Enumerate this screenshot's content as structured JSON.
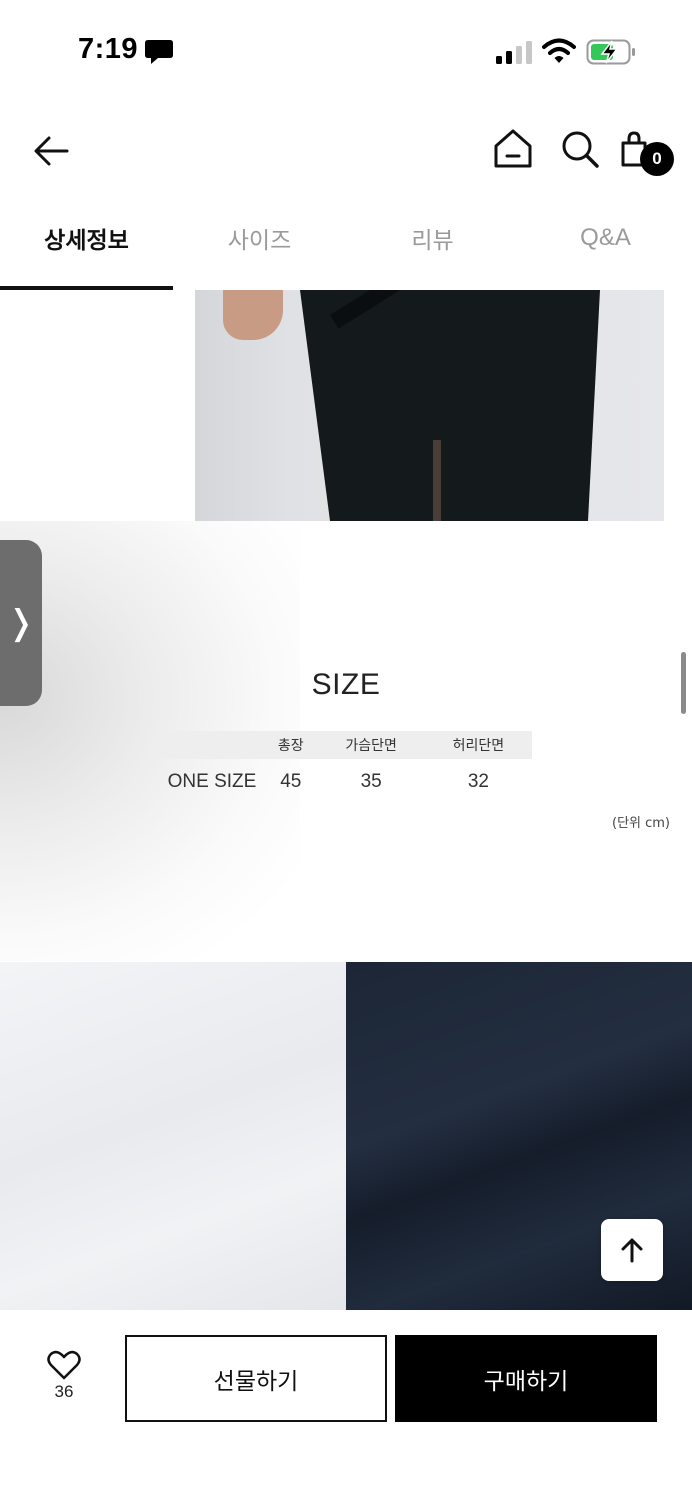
{
  "status_bar": {
    "time": "7:19",
    "icons": [
      "message-icon",
      "signal-icon",
      "wifi-icon",
      "battery-charging-icon"
    ]
  },
  "header": {
    "icons": [
      "back-arrow-icon",
      "home-icon",
      "search-icon",
      "shopping-bag-icon"
    ],
    "cart_count": "0"
  },
  "tabs": [
    {
      "label": "상세정보",
      "active": true
    },
    {
      "label": "사이즈",
      "active": false
    },
    {
      "label": "리뷰",
      "active": false
    },
    {
      "label": "Q&A",
      "active": false
    }
  ],
  "size_chart": {
    "title": "SIZE",
    "columns": [
      "",
      "총장",
      "가슴단면",
      "허리단면"
    ],
    "rows": [
      {
        "label": "ONE SIZE",
        "values": [
          "45",
          "35",
          "32"
        ]
      }
    ],
    "unit_note": "(단위 cm)"
  },
  "side_handle": {
    "glyph": "❭"
  },
  "bottom_bar": {
    "like_count": "36",
    "gift_label": "선물하기",
    "buy_label": "구매하기"
  },
  "colors": {
    "accent": "#000000",
    "tab_inactive": "#9a9a9a",
    "table_header_bg": "#eeeeee",
    "fabric_white": "#eceef1",
    "fabric_navy": "#1c2636"
  }
}
